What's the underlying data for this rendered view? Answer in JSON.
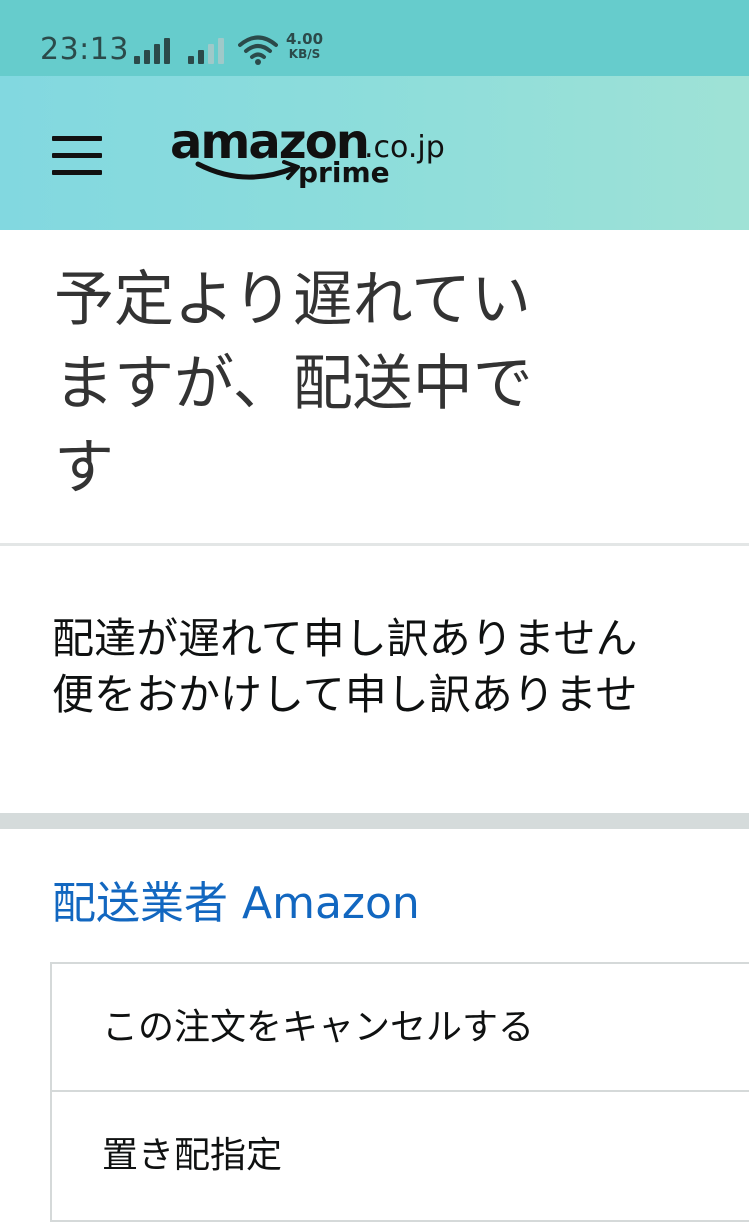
{
  "status_bar": {
    "time": "23:13",
    "net_speed_value": "4.00",
    "net_speed_unit": "KB/S",
    "background_color": "#66cccc"
  },
  "header": {
    "menu_icon": "hamburger-menu-icon",
    "logo": {
      "brand": "amazon",
      "domain": ".co.jp",
      "tier": "prime"
    },
    "background_color": "#8ddddb"
  },
  "main": {
    "title_lines": [
      "予定より遅れてい",
      "ますが、配送中で",
      "す"
    ],
    "message_lines": [
      "配達が遅れて申し訳ありません",
      "便をおかけして申し訳ありませ"
    ],
    "carrier": "配送業者 Amazon",
    "carrier_color": "#1267c0",
    "actions": [
      {
        "label": "この注文をキャンセルする"
      },
      {
        "label": "置き配指定"
      }
    ]
  }
}
